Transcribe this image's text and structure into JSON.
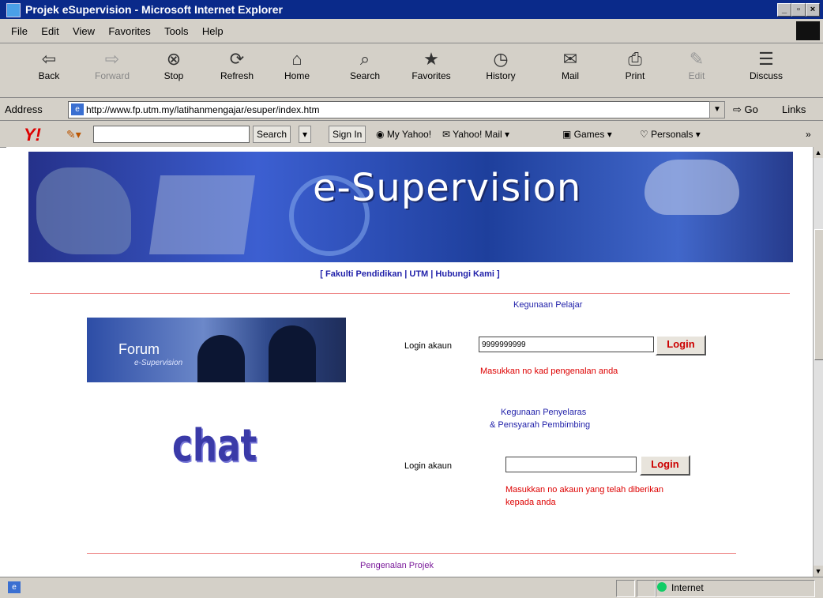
{
  "window": {
    "title": "Projek eSupervision - Microsoft Internet Explorer"
  },
  "menu": [
    "File",
    "Edit",
    "View",
    "Favorites",
    "Tools",
    "Help"
  ],
  "toolbar": [
    {
      "label": "Back",
      "icon": "⇦"
    },
    {
      "label": "Forward",
      "icon": "⇨"
    },
    {
      "label": "Stop",
      "icon": "⊗"
    },
    {
      "label": "Refresh",
      "icon": "⟳"
    },
    {
      "label": "Home",
      "icon": "⌂"
    },
    {
      "label": "Search",
      "icon": "⌕"
    },
    {
      "label": "Favorites",
      "icon": "★"
    },
    {
      "label": "History",
      "icon": "◷"
    },
    {
      "label": "Mail",
      "icon": "✉"
    },
    {
      "label": "Print",
      "icon": "⎙"
    },
    {
      "label": "Edit",
      "icon": "✎"
    },
    {
      "label": "Discuss",
      "icon": "☰"
    }
  ],
  "address": {
    "label": "Address",
    "url": "http://www.fp.utm.my/latihanmengajar/esuper/index.htm",
    "go": "Go",
    "links": "Links"
  },
  "yahoo": {
    "search_btn": "Search",
    "signin_btn": "Sign In",
    "myyahoo": "My Yahoo!",
    "mail": "Yahoo! Mail",
    "games": "Games",
    "personals": "Personals"
  },
  "page": {
    "banner_text": "e-Supervision",
    "nav_links": "[ Fakulti Pendidikan | UTM | Hubungi Kami ]",
    "student_heading": "Kegunaan Pelajar",
    "forum_title": "Forum",
    "forum_sub": "e-Supervision",
    "login_label_1": "Login akaun",
    "student_value": "9999999999",
    "login_btn_1": "Login",
    "student_hint": "Masukkan no kad pengenalan anda",
    "staff_heading_1": "Kegunaan Penyelaras",
    "staff_heading_2": "& Pensyarah Pembimbing",
    "chat": "chat",
    "login_label_2": "Login akaun",
    "login_btn_2": "Login",
    "staff_hint_1": "Masukkan no akaun yang telah diberikan",
    "staff_hint_2": "kepada anda",
    "footer_link": "Pengenalan Projek"
  },
  "status": {
    "zone": "Internet"
  }
}
